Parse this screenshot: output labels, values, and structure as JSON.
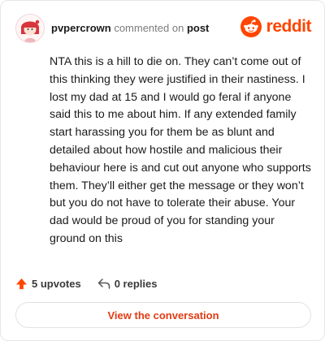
{
  "header": {
    "username": "pvpercrown",
    "action_text": "commented on",
    "post_link": "post",
    "brand_name": "reddit"
  },
  "comment": {
    "body": "NTA this is a hill to die on. They can’t come out of this thinking they were justified in their nastiness. I lost my dad at 15 and I would go feral if anyone said this to me about him. If any extended family start harassing you for them be as blunt and detailed about how hostile and malicious their behaviour here is and cut out anyone who supports them. They’ll either get the message or they won’t but you do not have to tolerate their abuse. Your dad would be proud of you for standing your ground on this"
  },
  "footer": {
    "upvotes": "5 upvotes",
    "replies": "0 replies",
    "cta_label": "View the conversation"
  },
  "icons": {
    "avatar": "user-avatar",
    "brand": "reddit-logo-icon",
    "upvote": "upvote-arrow-icon",
    "reply": "reply-arrow-icon"
  },
  "colors": {
    "accent": "#ff4500",
    "cta_text": "#e23b12",
    "text": "#1a1a1b",
    "muted": "#7c7c7c"
  }
}
